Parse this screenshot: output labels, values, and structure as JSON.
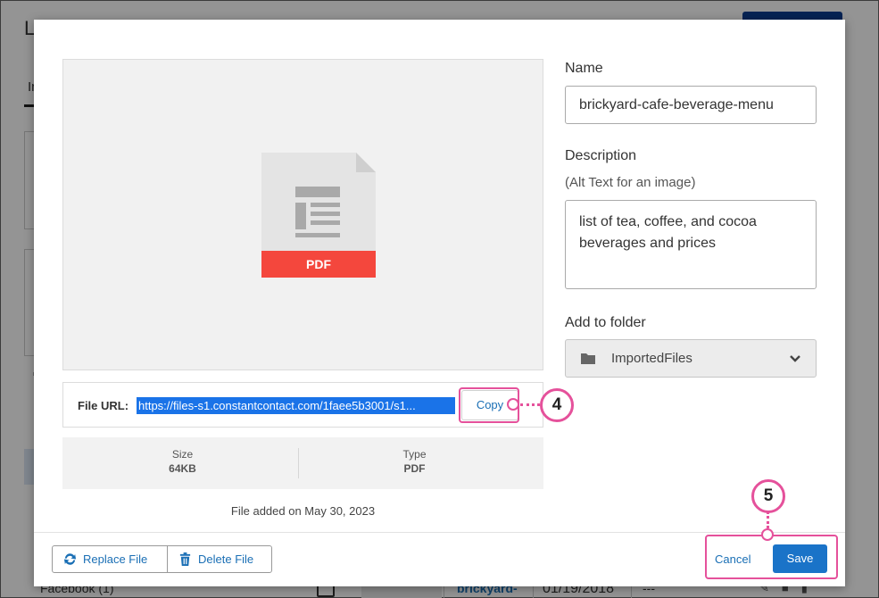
{
  "background": {
    "title_fragment": "Li",
    "tab_fragment": "In",
    "footer_row": {
      "folder_fragment": "Facebook (1)",
      "file_name_fragment": "brickyard-",
      "date": "01/19/2018",
      "size": "---"
    }
  },
  "preview": {
    "file_type_label": "PDF"
  },
  "file_url": {
    "label": "File URL:",
    "value": "https://files-s1.constantcontact.com/1faee5b3001/s1...",
    "copy_label": "Copy"
  },
  "meta": {
    "size_label": "Size",
    "size_value": "64KB",
    "type_label": "Type",
    "type_value": "PDF",
    "added_text": "File added on May 30, 2023"
  },
  "form": {
    "name_label": "Name",
    "name_value": "brickyard-cafe-beverage-menu",
    "description_label": "Description",
    "description_sub": "(Alt Text for an image)",
    "description_value": "list of tea, coffee, and cocoa beverages and prices",
    "folder_label": "Add to folder",
    "folder_value": "ImportedFiles"
  },
  "footer": {
    "replace_label": "Replace File",
    "delete_label": "Delete File",
    "cancel_label": "Cancel",
    "save_label": "Save"
  },
  "callouts": {
    "step_copy": "4",
    "step_save": "5"
  },
  "colors": {
    "accent_pink": "#e5519b",
    "link_blue": "#1a6fb5",
    "save_blue": "#1a73c8",
    "pdf_red": "#f4473d"
  }
}
